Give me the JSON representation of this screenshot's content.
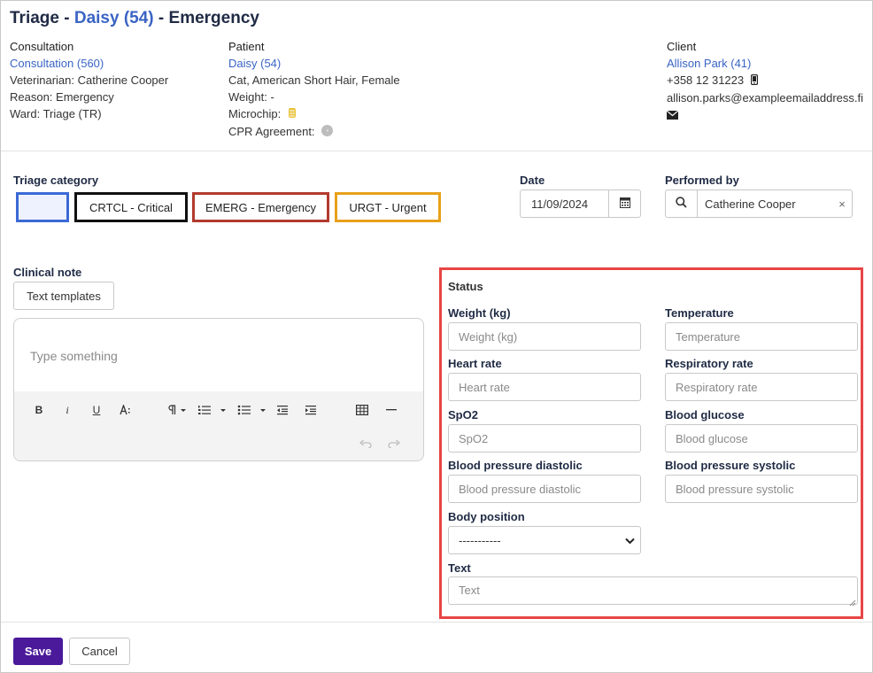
{
  "header": {
    "title_prefix": "Triage - ",
    "patient_link": "Daisy (54)",
    "title_suffix": " - Emergency"
  },
  "consultation": {
    "heading": "Consultation",
    "link": "Consultation (560)",
    "veterinarian": "Veterinarian: Catherine Cooper",
    "reason": "Reason: Emergency",
    "ward": "Ward: Triage (TR)"
  },
  "patient": {
    "heading": "Patient",
    "link": "Daisy (54)",
    "description": "Cat, American Short Hair, Female",
    "weight": "Weight: -",
    "microchip": "Microchip:",
    "cpr": "CPR Agreement:"
  },
  "client": {
    "heading": "Client",
    "link": "Allison Park (41)",
    "phone": "+358 12 31223",
    "email": "allison.parks@exampleemailaddress.fi"
  },
  "triage": {
    "label": "Triage category",
    "options": [
      "",
      "CRTCL - Critical",
      "EMERG - Emergency",
      "URGT - Urgent"
    ]
  },
  "date": {
    "label": "Date",
    "value": "11/09/2024"
  },
  "performed_by": {
    "label": "Performed by",
    "value": "Catherine Cooper",
    "clear": "×"
  },
  "clinical_note": {
    "label": "Clinical note",
    "templates_button": "Text templates",
    "placeholder": "Type something"
  },
  "status": {
    "title": "Status",
    "fields": {
      "weight": {
        "label": "Weight (kg)",
        "placeholder": "Weight (kg)"
      },
      "temperature": {
        "label": "Temperature",
        "placeholder": "Temperature"
      },
      "heart_rate": {
        "label": "Heart rate",
        "placeholder": "Heart rate"
      },
      "respiratory_rate": {
        "label": "Respiratory rate",
        "placeholder": "Respiratory rate"
      },
      "spo2": {
        "label": "SpO2",
        "placeholder": "SpO2"
      },
      "blood_glucose": {
        "label": "Blood glucose",
        "placeholder": "Blood glucose"
      },
      "bp_diastolic": {
        "label": "Blood pressure diastolic",
        "placeholder": "Blood pressure diastolic"
      },
      "bp_systolic": {
        "label": "Blood pressure systolic",
        "placeholder": "Blood pressure systolic"
      },
      "body_position": {
        "label": "Body position",
        "value": "-----------"
      },
      "text": {
        "label": "Text",
        "placeholder": "Text"
      }
    }
  },
  "footer": {
    "save": "Save",
    "cancel": "Cancel"
  },
  "colors": {
    "link": "#3a64c4",
    "save": "#4a1a9a",
    "status_border": "#e84545",
    "critical": "#111111",
    "emergency": "#b23a2e",
    "urgent": "#e8a01a",
    "none": "#3b6ad6"
  }
}
